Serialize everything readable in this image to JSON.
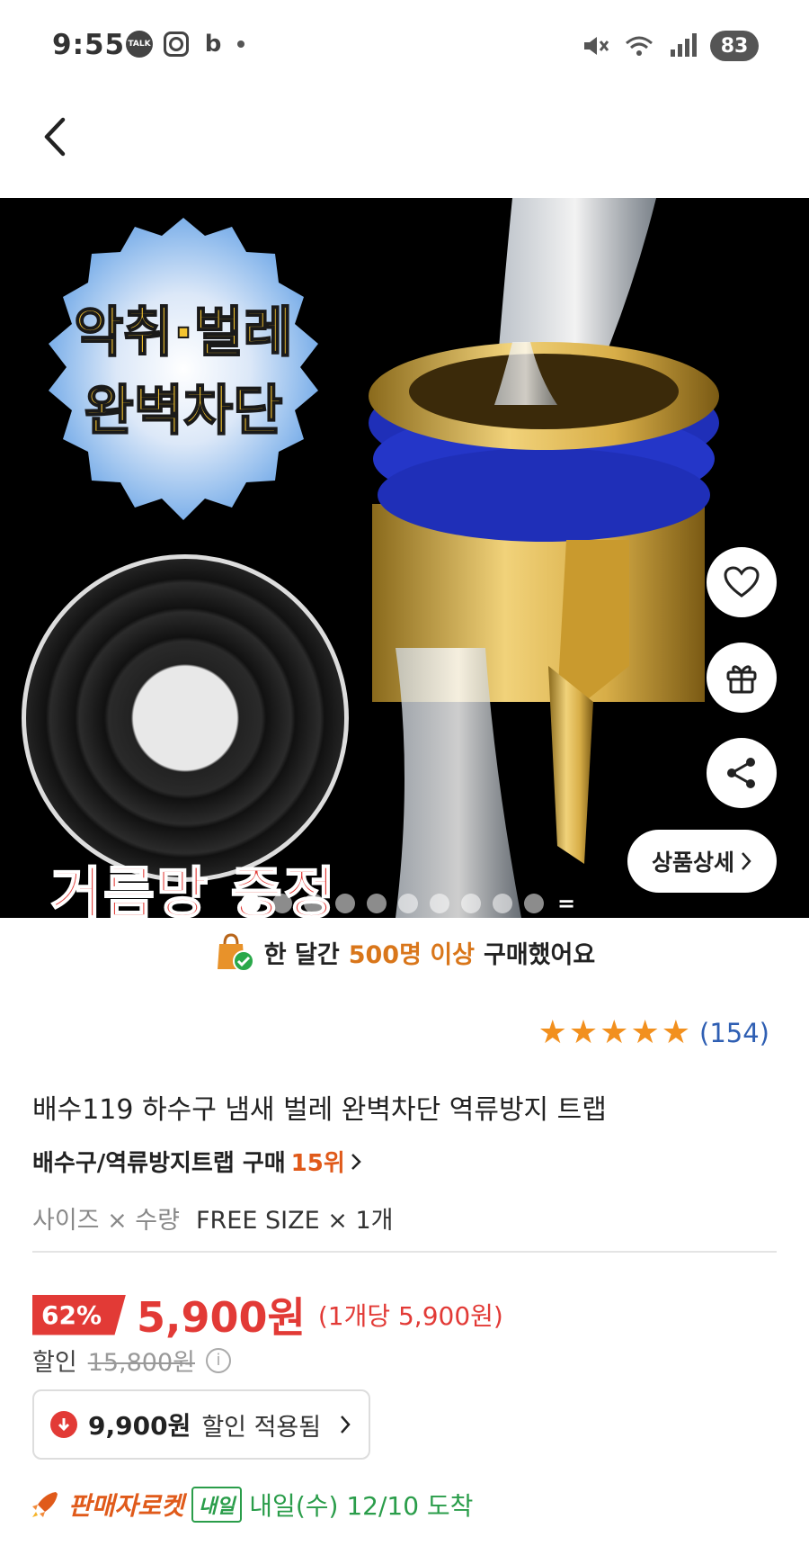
{
  "status_bar": {
    "time": "9:55",
    "apps": [
      "kakaotalk-icon",
      "instagram-icon",
      "band-icon"
    ],
    "battery": "83"
  },
  "header": {
    "back_icon": "chevron-left-icon"
  },
  "hero": {
    "badge_line1": "악취·벌레",
    "badge_line2": "완벽차단",
    "giveaway": "거름망 증정",
    "detail_button": "상품상세",
    "dots_count": 10,
    "active_dot": 0
  },
  "purchase_banner": {
    "prefix": "한 달간",
    "highlight": "500명 이상",
    "suffix": "구매했어요"
  },
  "rating": {
    "stars": 5,
    "count": "(154)"
  },
  "product": {
    "title": "배수119 하수구 냄새 벌레 완벽차단 역류방지 트랩",
    "rank_category": "배수구/역류방지트랩 구매",
    "rank": "15위",
    "option_label": "사이즈 × 수량",
    "option_value": "FREE SIZE × 1개"
  },
  "price": {
    "discount": "62%",
    "sale": "5,900원",
    "unit": "(1개당 5,900원)",
    "orig_label": "할인",
    "original": "15,800원"
  },
  "coupon": {
    "price": "9,900원",
    "text": "할인 적용됨"
  },
  "delivery": {
    "label": "판매자로켓",
    "badge": "내일",
    "arrival": "내일(수) 12/10 도착"
  },
  "colors": {
    "accent_red": "#e23a36",
    "accent_orange": "#e05a1a",
    "star": "#f2901e",
    "link_blue": "#2f5fb3",
    "green": "#2a9d4a"
  }
}
